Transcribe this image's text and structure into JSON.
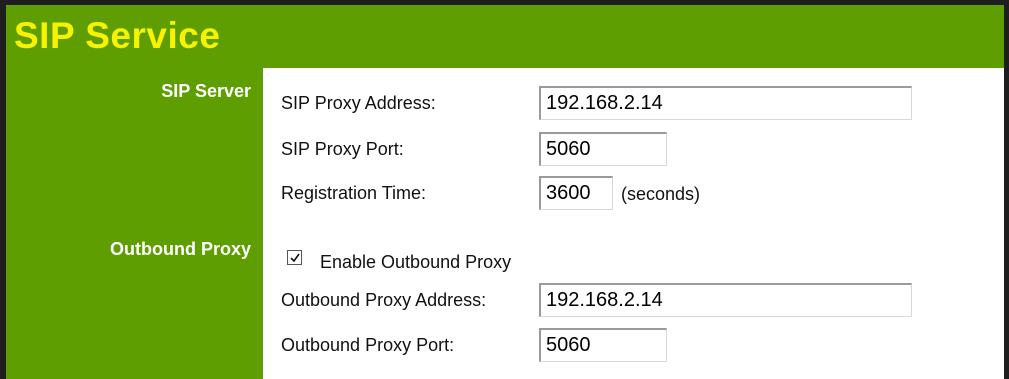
{
  "header": {
    "title": "SIP Service"
  },
  "sections": {
    "sip_server": {
      "label": "SIP Server"
    },
    "outbound_proxy": {
      "label": "Outbound Proxy"
    }
  },
  "fields": {
    "proxy_address": {
      "label": "SIP Proxy Address:",
      "value": "192.168.2.14"
    },
    "proxy_port": {
      "label": "SIP Proxy Port:",
      "value": "5060"
    },
    "registration_time": {
      "label": "Registration Time:",
      "value": "3600",
      "unit": "(seconds)"
    },
    "enable_outbound": {
      "label": "Enable Outbound Proxy",
      "checked": true
    },
    "outbound_address": {
      "label": "Outbound Proxy Address:",
      "value": "192.168.2.14"
    },
    "outbound_port": {
      "label": "Outbound Proxy Port:",
      "value": "5060"
    }
  },
  "colors": {
    "header_bg": "#5e9e00",
    "title_text": "#f6f200",
    "section_text": "#ffffff"
  }
}
